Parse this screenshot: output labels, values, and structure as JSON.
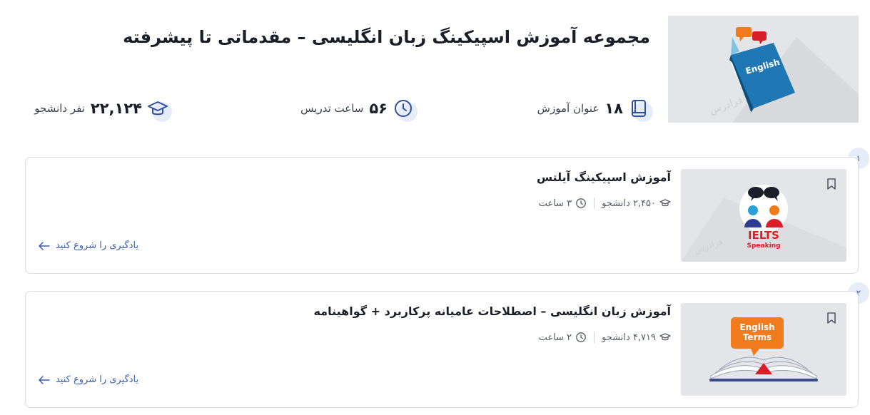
{
  "course_set": {
    "title": "مجموعه آموزش اسپیکینگ زبان انگلیسی – مقدماتی تا پیشرفته",
    "cover_book_label": "English",
    "watermark": "فرادرس"
  },
  "stats": {
    "courses": {
      "value": "۱۸",
      "label": "عنوان آموزش",
      "icon": "courses-icon"
    },
    "hours": {
      "value": "۵۶",
      "label": "ساعت تدریس",
      "icon": "clock-icon"
    },
    "students": {
      "value": "۲۲,۱۲۴",
      "label": "نفر دانشجو",
      "icon": "graduation-cap-icon"
    }
  },
  "courses": [
    {
      "index": "۱",
      "title": "آموزش اسپیکینگ آیلتس",
      "students": "۲,۴۵۰ دانشجو",
      "hours": "۳ ساعت",
      "cta": "یادگیری را شروع کنید",
      "thumb_line1": "IELTS",
      "thumb_line2": "Speaking",
      "watermark": "فرادرس"
    },
    {
      "index": "۲",
      "title": "آموزش زبان انگلیسی – اصطلاحات عامیانه پرکاربرد + گواهینامه",
      "students": "۴,۷۱۹ دانشجو",
      "hours": "۲ ساعت",
      "cta": "یادگیری را شروع کنید",
      "thumb_line1": "English",
      "thumb_line2": "Terms"
    }
  ],
  "colors": {
    "accent": "#3a5fb0",
    "icon_blob": "#e6ecf8",
    "book_blue": "#1f78b4",
    "ielts_red": "#d61f26",
    "terms_orange": "#f07c1e"
  }
}
